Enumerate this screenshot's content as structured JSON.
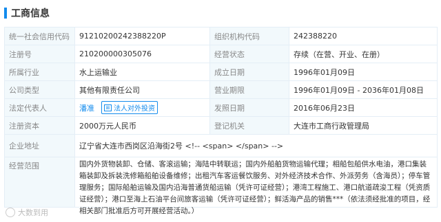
{
  "header": {
    "title": "工商信息"
  },
  "rows": [
    {
      "l1": "统一社会信用代码",
      "v1": "91210200242388220P",
      "l2": "组织机构代码",
      "v2": "242388220"
    },
    {
      "l1": "注册号",
      "v1": "210200000305076",
      "l2": "经营状态",
      "v2": "存续（在营、开业、在册）"
    },
    {
      "l1": "所属行业",
      "v1": "水上运输业",
      "l2": "成立日期",
      "v2": "1996年01月09日"
    },
    {
      "l1": "公司类型",
      "v1": "其他有限责任公司",
      "l2": "营业期限",
      "v2": "1996年01月09日 - 2036年01月08日"
    },
    {
      "l1": "法定代表人",
      "v1": "潘准",
      "tag": "法人对外投资",
      "l2": "发照日期",
      "v2": "2016年06月23日"
    },
    {
      "l1": "注册资本",
      "v1": "2000万元人民币",
      "l2": "登记机关",
      "v2": "大连市工商行政管理局"
    }
  ],
  "address": {
    "label": "企业地址",
    "value": "辽宁省大连市西岗区沿海街2号 <!-- <span> </span> -->"
  },
  "scope": {
    "label": "经营范围",
    "value": "国内外货物装卸、仓储、客滚运输；海陆中转联运；国内外船舶货物运输代理；相船包船供水电油，港口集装箱装卸及拆装洗修箱船舶设备维修；出租汽车客运餐饮服务、对外经济技术合作、外派劳务（含海员）；停车管理服务；国际船舶运输及国内沿海普通货船运输（凭许可证经营）；港湾工程施工、港口航道疏浚工程（凭资质证经营）；港口至海上石油平台间旅客运输（凭许可证经营）；鲜活海产品的销售***（依法须经批准的项目，经相关部门批准后方可开展经营活动。）"
  },
  "watermark": {
    "text": "大数到用"
  },
  "colors": {
    "accent": "#128bed",
    "label_bg": "#f2f9fc",
    "border": "#e4eef6"
  }
}
